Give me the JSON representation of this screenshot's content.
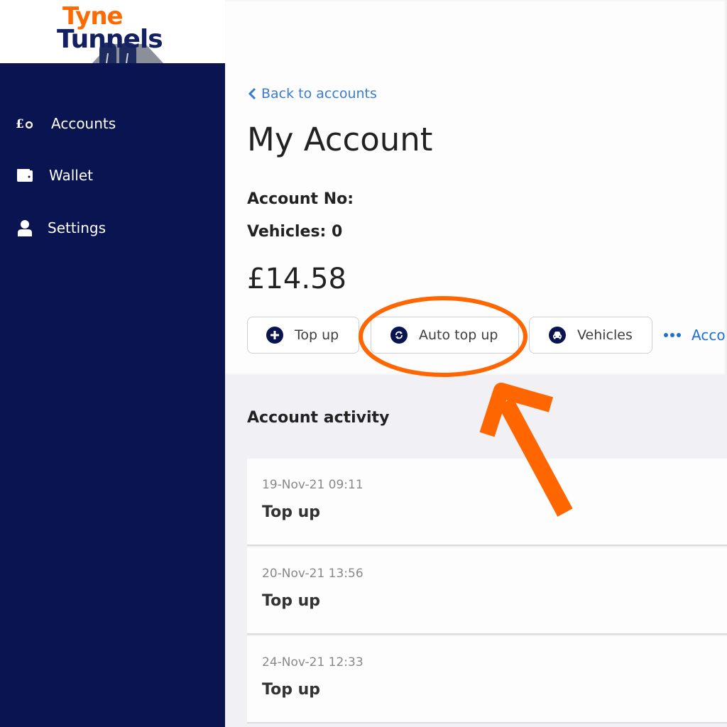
{
  "brand": {
    "logo_line1": "Tyne",
    "logo_line2": "Tunnels",
    "logo_colors": {
      "orange": "#ff6a00",
      "navy": "#132062"
    }
  },
  "sidebar": {
    "background": "#0a1450",
    "items": [
      {
        "label": "Accounts",
        "icon": "pound-coin-icon"
      },
      {
        "label": "Wallet",
        "icon": "wallet-icon"
      },
      {
        "label": "Settings",
        "icon": "user-icon"
      }
    ]
  },
  "account": {
    "back_link": "Back to accounts",
    "title": "My Account",
    "account_no_label": "Account No:",
    "account_no_value": "",
    "vehicles_label": "Vehicles: 0",
    "balance": "£14.58"
  },
  "actions": [
    {
      "label": "Top up",
      "icon": "plus-circle-icon"
    },
    {
      "label": "Auto top up",
      "icon": "refresh-circle-icon",
      "highlighted": true
    },
    {
      "label": "Vehicles",
      "icon": "car-circle-icon"
    }
  ],
  "more_link": {
    "label": "Acco",
    "icon": "ellipsis-icon"
  },
  "activity": {
    "title": "Account activity",
    "items": [
      {
        "date": "19-Nov-21 09:11",
        "type": "Top up"
      },
      {
        "date": "20-Nov-21 13:56",
        "type": "Top up"
      },
      {
        "date": "24-Nov-21 12:33",
        "type": "Top up"
      }
    ]
  },
  "annotation": {
    "color": "#ff6600",
    "target": "Auto top up"
  }
}
